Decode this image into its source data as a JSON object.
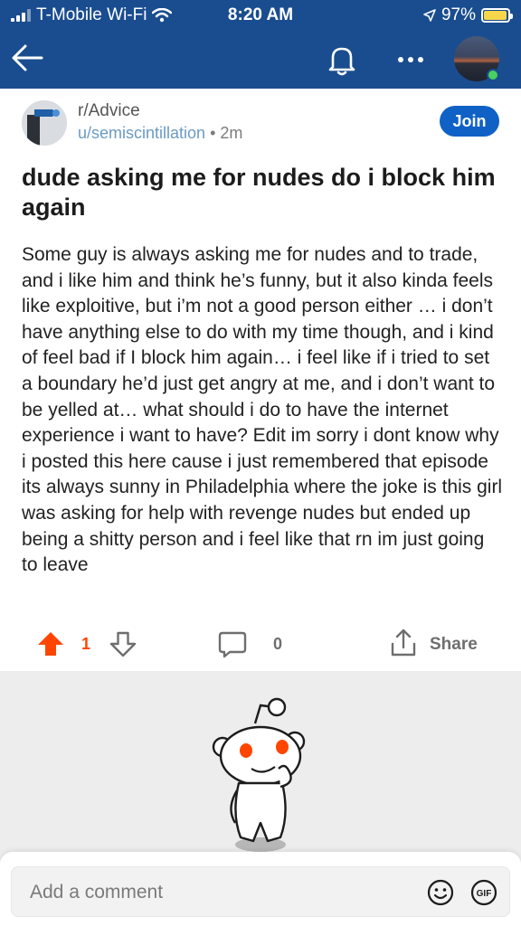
{
  "status": {
    "carrier": "T-Mobile Wi-Fi",
    "time": "8:20 AM",
    "battery": "97%",
    "battery_level": 0.97
  },
  "nav": {
    "back_icon": "arrow-left-icon",
    "bell_icon": "bell-icon",
    "more_icon": "more-dots-icon"
  },
  "post": {
    "subreddit": "r/Advice",
    "username": "u/semiscintillation",
    "separator": "•",
    "age": "2m",
    "join_label": "Join",
    "title": "dude asking me for nudes do i block him again",
    "body": "Some guy is always asking me for nudes and to trade, and i like him and think he’s funny, but it also kinda feels like exploitive, but i’m not a good person either … i don’t have anything else to do with my time though, and i kind of feel bad if I block him again… i feel like if i tried to set a boundary he’d just get angry at me, and i don’t want to be yelled at… what should i do to have the internet experience i want to have? Edit im sorry i dont know why i posted this here cause i just remembered that episode its always sunny in Philadelphia where the joke is this girl was asking for help with revenge nudes but ended up being a shitty person and i feel like that rn im just going to leave"
  },
  "actions": {
    "score": "1",
    "comments": "0",
    "share_label": "Share",
    "upvote_color": "#ff4500"
  },
  "comment_bar": {
    "placeholder": "Add a comment",
    "gif_label": "GIF"
  },
  "colors": {
    "header": "#1a4d8f",
    "join": "#0f61c5",
    "username": "#6a9bc4"
  }
}
